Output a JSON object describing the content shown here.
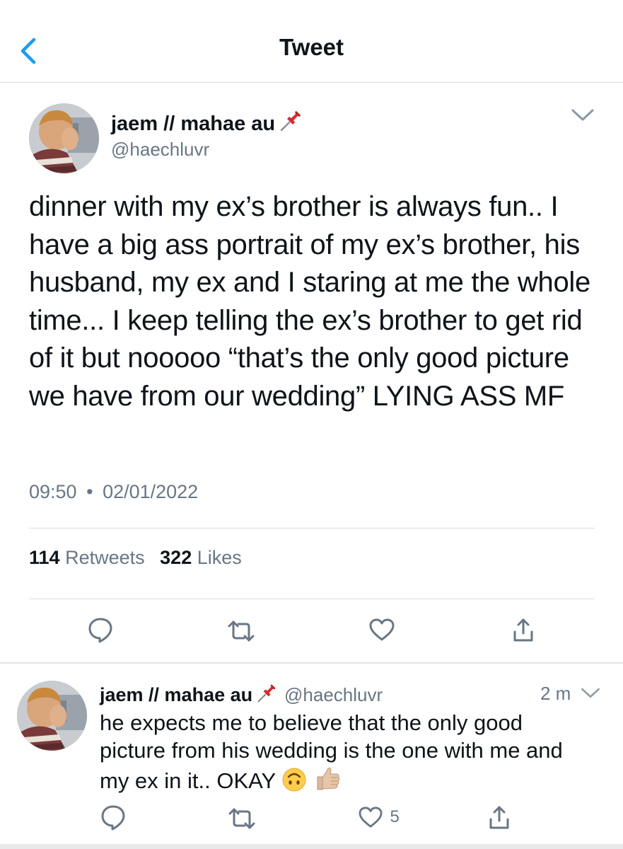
{
  "nav": {
    "title": "Tweet"
  },
  "tweet": {
    "display_name": "jaem // mahae au",
    "handle": "@haechluvr",
    "text": "dinner with my ex’s brother is always fun.. I have a big ass portrait of my ex’s brother, his husband, my ex and I staring at me the whole time... I keep telling the ex’s brother to get rid of it but nooooo “that’s the only good picture we have from our wedding” LYING ASS MF",
    "time": "09:50",
    "date": "02/01/2022",
    "retweets_count": "114",
    "retweets_label": "Retweets",
    "likes_count": "322",
    "likes_label": "Likes"
  },
  "reply": {
    "display_name": "jaem // mahae au",
    "handle": "@haechluvr",
    "time_ago": "2 m",
    "text": "he expects me to believe that the only good picture from his wedding is the one with me and my ex in it.. OKAY",
    "like_count": "5"
  },
  "icons": {
    "back": "chevron-left-icon",
    "pin": "pushpin-icon",
    "more": "chevron-down-icon",
    "reply": "reply-icon",
    "retweet": "retweet-icon",
    "like": "heart-icon",
    "share": "share-icon"
  },
  "colors": {
    "accent": "#1d9bf0",
    "muted": "#687684",
    "divider": "#d9dde0",
    "text": "#0f1419"
  }
}
